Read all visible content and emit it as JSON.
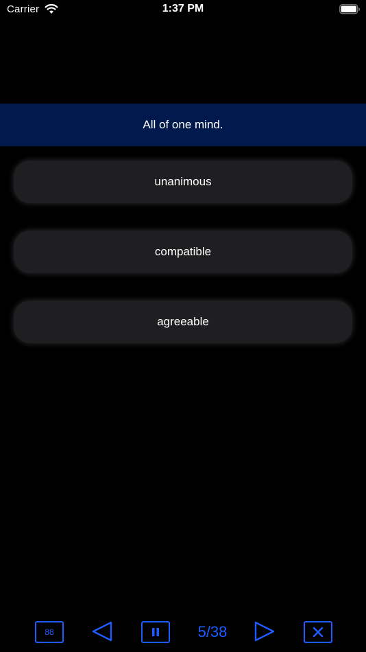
{
  "status_bar": {
    "carrier": "Carrier",
    "time": "1:37 PM",
    "wifi_icon": "wifi-icon",
    "battery_icon": "battery-icon"
  },
  "question": {
    "text": "All of one mind."
  },
  "answers": [
    {
      "label": "unanimous"
    },
    {
      "label": "compatible"
    },
    {
      "label": "agreeable"
    }
  ],
  "toolbar": {
    "grid_label": "88",
    "grid_icon": "grid-icon",
    "prev_icon": "triangle-left-icon",
    "pause_icon": "pause-icon",
    "progress": "5/38",
    "next_icon": "triangle-right-icon",
    "close_icon": "close-icon"
  },
  "colors": {
    "background": "#000000",
    "banner": "#001a4d",
    "answer_bg": "#1f1f21",
    "accent": "#1f5cff"
  }
}
